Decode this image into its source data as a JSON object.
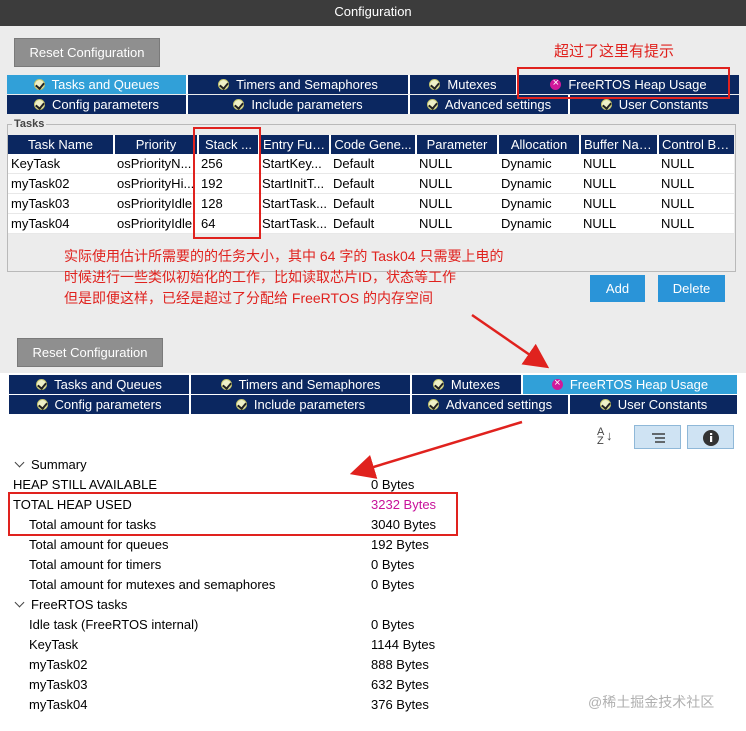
{
  "window": {
    "title": "Configuration"
  },
  "reset_button": "Reset Configuration",
  "annotations": {
    "exceeded_note": "超过了这里有提示",
    "explain_line1": "实际使用估计所需要的的任务大小，其中 64 字的 Task04 只需要上电的",
    "explain_line2": "时候进行一些类似初始化的工作，比如读取芯片ID，状态等工作",
    "explain_line3": "但是即便这样，已经是超过了分配给 FreeRTOS 的内存空间"
  },
  "tabs_row1": [
    {
      "label": "Tasks and Queues",
      "icon": "check-icon"
    },
    {
      "label": "Timers and Semaphores",
      "icon": "check-icon"
    },
    {
      "label": "Mutexes",
      "icon": "check-icon"
    },
    {
      "label": "FreeRTOS Heap Usage",
      "icon": "error-icon"
    }
  ],
  "tabs_row2": [
    {
      "label": "Config parameters",
      "icon": "check-icon"
    },
    {
      "label": "Include parameters",
      "icon": "check-icon"
    },
    {
      "label": "Advanced settings",
      "icon": "check-icon"
    },
    {
      "label": "User Constants",
      "icon": "check-icon"
    }
  ],
  "tasks": {
    "legend": "Tasks",
    "columns": [
      "Task Name",
      "Priority",
      "Stack ...",
      "Entry Fun...",
      "Code Gene...",
      "Parameter",
      "Allocation",
      "Buffer Name",
      "Control Blo..."
    ],
    "rows": [
      [
        "KeyTask",
        "osPriorityN...",
        "256",
        "StartKey...",
        "Default",
        "NULL",
        "Dynamic",
        "NULL",
        "NULL"
      ],
      [
        "myTask02",
        "osPriorityHi...",
        "192",
        "StartInitT...",
        "Default",
        "NULL",
        "Dynamic",
        "NULL",
        "NULL"
      ],
      [
        "myTask03",
        "osPriorityIdle",
        "128",
        "StartTask...",
        "Default",
        "NULL",
        "Dynamic",
        "NULL",
        "NULL"
      ],
      [
        "myTask04",
        "osPriorityIdle",
        "64",
        "StartTask...",
        "Default",
        "NULL",
        "Dynamic",
        "NULL",
        "NULL"
      ]
    ],
    "add_button": "Add",
    "delete_button": "Delete"
  },
  "heap": {
    "summary_label": "Summary",
    "rows": [
      {
        "name": "HEAP STILL AVAILABLE",
        "value": "0  Bytes",
        "indent": 0
      },
      {
        "name": "TOTAL HEAP USED",
        "value": "3232  Bytes",
        "indent": 0,
        "highlight": true
      },
      {
        "name": "Total amount for tasks",
        "value": "3040  Bytes",
        "indent": 1
      },
      {
        "name": "Total amount for queues",
        "value": "192  Bytes",
        "indent": 1
      },
      {
        "name": "Total amount for timers",
        "value": "0  Bytes",
        "indent": 1
      },
      {
        "name": "Total amount for mutexes and semaphores",
        "value": "0  Bytes",
        "indent": 1
      }
    ],
    "tasks_label": "FreeRTOS tasks",
    "task_rows": [
      {
        "name": "Idle task (FreeRTOS internal)",
        "value": "0  Bytes"
      },
      {
        "name": "KeyTask",
        "value": "1144  Bytes"
      },
      {
        "name": "myTask02",
        "value": "888  Bytes"
      },
      {
        "name": "myTask03",
        "value": "632  Bytes"
      },
      {
        "name": "myTask04",
        "value": "376  Bytes"
      }
    ],
    "highlight_color": "#c8129a"
  },
  "watermark": "@稀土掘金技术社区",
  "colors": {
    "tab_bg": "#0b2760",
    "tab_active": "#31a0d8",
    "annotation_red": "#e0221e",
    "button_blue": "#2a94d8"
  }
}
